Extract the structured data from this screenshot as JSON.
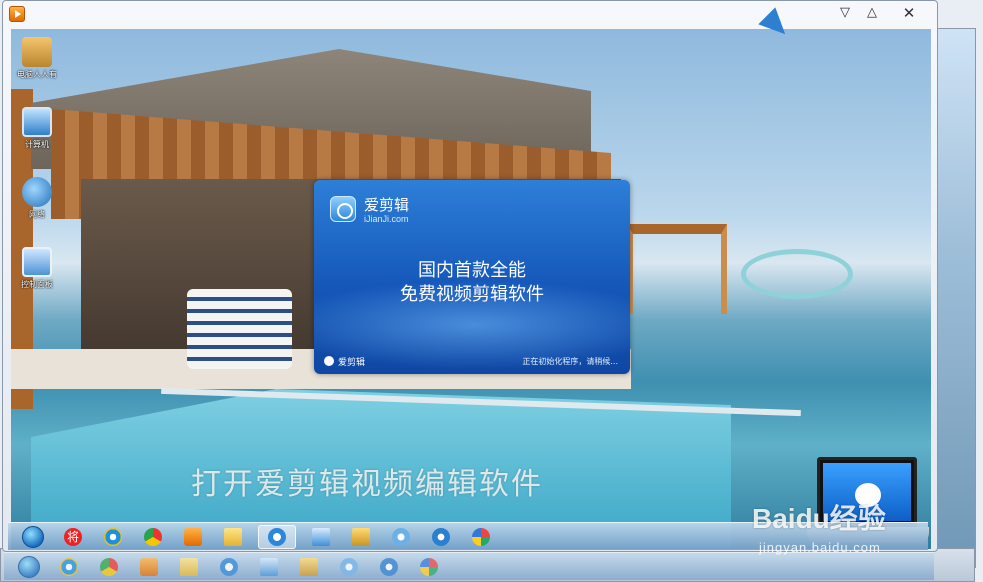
{
  "window": {
    "controls": {
      "minimize_glyph": "▽",
      "maximize_glyph": "△",
      "close_glyph": "✕"
    }
  },
  "desktop": {
    "icons": [
      {
        "label": "电脑人人有",
        "icon": "user-folder-icon"
      },
      {
        "label": "计算机",
        "icon": "computer-icon"
      },
      {
        "label": "网络",
        "icon": "network-icon"
      },
      {
        "label": "控制面板",
        "icon": "control-panel-icon"
      }
    ]
  },
  "splash": {
    "app_name": "爱剪辑",
    "domain": "iJianJi.com",
    "headline_1": "国内首款全能",
    "headline_2": "免费视频剪辑软件",
    "footer_name": "爱剪辑",
    "status": "正在初始化程序，请稍候..."
  },
  "caption": "打开爱剪辑视频编辑软件",
  "watermark": {
    "main": "Baidu经验",
    "sub": "jingyan.baidu.com"
  },
  "taskbar": {
    "items": [
      {
        "icon": "start-orb-icon"
      },
      {
        "icon": "jiang-app-icon",
        "text": "将"
      },
      {
        "icon": "ie-icon"
      },
      {
        "icon": "chrome-icon"
      },
      {
        "icon": "media-player-icon"
      },
      {
        "icon": "folder-icon"
      },
      {
        "icon": "aijianji-icon",
        "active": true
      },
      {
        "icon": "control-panel-icon"
      },
      {
        "icon": "explorer-icon"
      },
      {
        "icon": "bird-app-icon"
      },
      {
        "icon": "film-app-icon"
      },
      {
        "icon": "paint-icon"
      }
    ]
  }
}
